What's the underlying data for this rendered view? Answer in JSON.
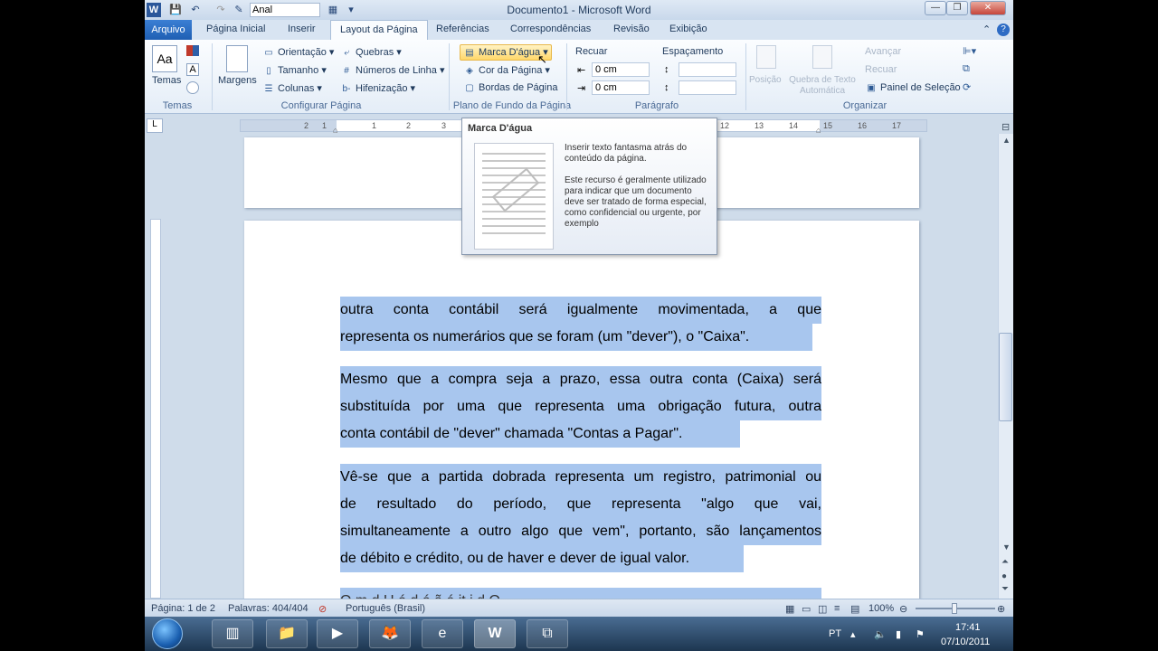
{
  "title_bar": {
    "title": "Documento1 - Microsoft Word",
    "font_box": "Anal",
    "minimize": "—",
    "restore": "❐",
    "close": "✕"
  },
  "tabs": {
    "file": "Arquivo",
    "items": [
      "Página Inicial",
      "Inserir",
      "Layout da Página",
      "Referências",
      "Correspondências",
      "Revisão",
      "Exibição"
    ],
    "active": "Layout da Página"
  },
  "ribbon": {
    "temas": {
      "button": "Temas",
      "group": "Temas"
    },
    "configurar": {
      "margens": "Margens",
      "orientacao": "Orientação",
      "tamanho": "Tamanho",
      "colunas": "Colunas",
      "quebras": "Quebras",
      "numeros_linha": "Números de Linha",
      "hifenizacao": "Hifenização",
      "group": "Configurar Página"
    },
    "plano_fundo": {
      "marca_dagua": "Marca D'água",
      "cor_pagina": "Cor da Página",
      "bordas_pagina": "Bordas de Página",
      "group": "Plano de Fundo da Página"
    },
    "paragrafo": {
      "recuar": "Recuar",
      "espacamento": "Espaçamento",
      "recuo_esq": "0 cm",
      "recuo_dir": "0 cm",
      "group": "Parágrafo"
    },
    "organizar": {
      "posicao": "Posição",
      "quebra_texto": "Quebra de Texto Automática",
      "avancar": "Avançar",
      "recuar": "Recuar",
      "painel_selecao": "Painel de Seleção",
      "group": "Organizar"
    }
  },
  "ruler": {
    "ticks": [
      "2",
      "1",
      "1",
      "2",
      "3",
      "12",
      "13",
      "14",
      "15",
      "16",
      "17"
    ]
  },
  "tooltip": {
    "title": "Marca D'água",
    "line1": "Inserir texto fantasma atrás do conteúdo da página.",
    "line2": "Este recurso é geralmente utilizado para indicar que um documento deve ser tratado de forma especial, como confidencial ou urgente, por exemplo"
  },
  "document": {
    "lines": [
      "outra conta contábil será igualmente movimentada, a que",
      "representa os numerários que se foram (um \"dever\"), o \"Caixa\".",
      "Mesmo que a compra seja a prazo, essa outra conta (Caixa) será",
      "substituída por uma que representa uma obrigação futura, outra",
      "conta contábil de \"dever\" chamada \"Contas a Pagar\".",
      "Vê-se que a partida dobrada representa um registro, patrimonial ou",
      "de resultado do período, que representa \"algo que vai,",
      "simultaneamente a outro algo que vem\", portanto, são lançamentos",
      "de débito e crédito, ou de haver e dever de igual valor.",
      "O          m    d     U ó           d     ó          ã  é          it   i   d      O"
    ]
  },
  "status_bar": {
    "pagina": "Página: 1 de 2",
    "palavras": "Palavras: 404/404",
    "idioma": "Português (Brasil)",
    "zoom": "100%"
  },
  "taskbar": {
    "lang": "PT",
    "time": "17:41",
    "date": "07/10/2011"
  }
}
